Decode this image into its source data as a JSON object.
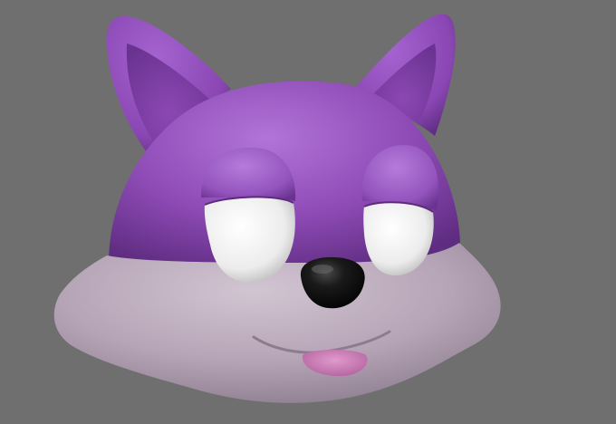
{
  "scene": {
    "subject": "fox-head-3d-model",
    "colors": {
      "background": "#6f6f6f",
      "fur_purple": "#8e4bb6",
      "fur_purple_light": "#a866d0",
      "fur_purple_dark": "#5e2c80",
      "muzzle_gray": "#b7a6b7",
      "muzzle_gray_light": "#cfc2cf",
      "muzzle_gray_dark": "#8d7f8f",
      "eye_white": "#f2f2f2",
      "nose_black": "#151515",
      "tongue_pink": "#c876b4"
    },
    "icons": [
      "fox-head-icon",
      "ear-icon",
      "eye-icon",
      "nose-icon",
      "tongue-icon"
    ]
  }
}
